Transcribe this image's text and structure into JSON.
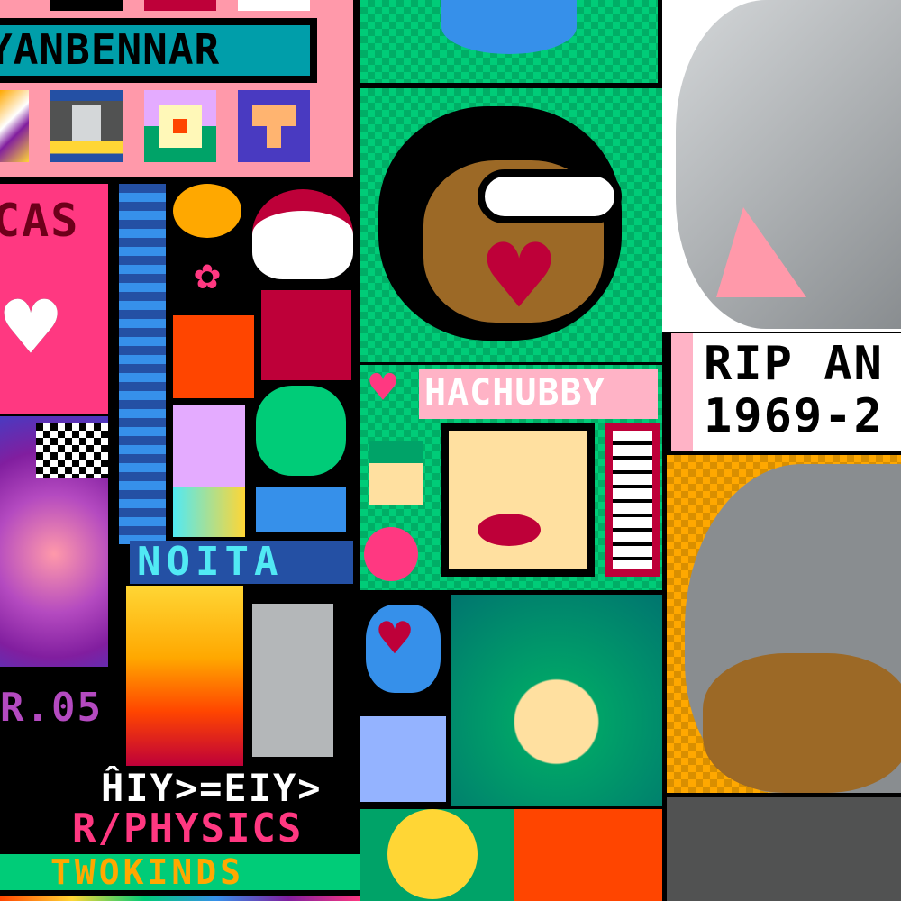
{
  "canvas": {
    "banner_top": "YANBENNAR",
    "cas_label": "CAS",
    "noita_label": "NOITA",
    "hachubby_label": "HACHUBBY",
    "rip_line1": "RIP AN",
    "rip_line2": "1969-2",
    "version_label": "R.05",
    "formula_label": "ĤIY>=EIY>",
    "physics_label": "R/PHYSICS",
    "twokinds_label": "TWOKINDS"
  },
  "colors": {
    "pink": "#ff99aa",
    "hot_pink": "#ff3881",
    "teal": "#009eaa",
    "green": "#00cc78",
    "dark_green": "#00a368",
    "orange": "#ffa800",
    "grey": "#898d90",
    "blue": "#3690ea",
    "purple": "#811e9f",
    "black": "#000000",
    "white": "#ffffff"
  }
}
